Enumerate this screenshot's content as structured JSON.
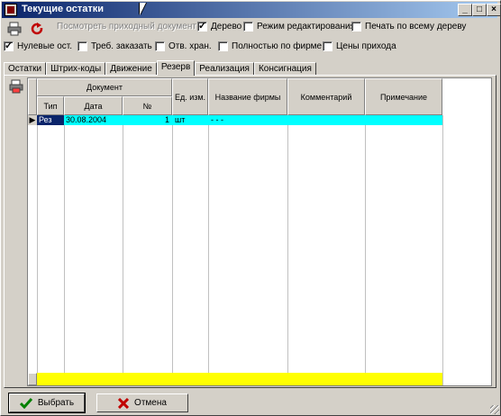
{
  "window": {
    "title": "Текущие остатки",
    "min": "_",
    "max": "□",
    "close": "×"
  },
  "toolbar": {
    "view_doc": "Посмотреть приходный документ",
    "tree": "Дерево",
    "edit_mode": "Режим редактирования",
    "print_tree": "Печать по всему дереву"
  },
  "filters": {
    "zero": "Нулевые ост.",
    "need_order": "Треб. заказать",
    "resp_store": "Отв. хран.",
    "by_company": "Полностью по фирме",
    "prices": "Цены прихода"
  },
  "tabs": [
    "Остатки",
    "Штрих-коды",
    "Движение",
    "Резерв",
    "Реализация",
    "Консигнация"
  ],
  "grid": {
    "doc_group": "Документ",
    "columns": [
      "Тип",
      "Дата",
      "№",
      "Ед. изм.",
      "Название фирмы",
      "Комментарий",
      "Примечание"
    ],
    "rows": [
      {
        "type": "Рез",
        "date": "30.08.2004",
        "num": "1",
        "unit": "шт",
        "firm": "- - -",
        "comment": "",
        "note": ""
      }
    ]
  },
  "buttons": {
    "ok": "Выбрать",
    "cancel": "Отмена"
  },
  "colors": {
    "title_start": "#0a246a",
    "selected_row": "#00ffff",
    "total_row": "#ffff00"
  }
}
